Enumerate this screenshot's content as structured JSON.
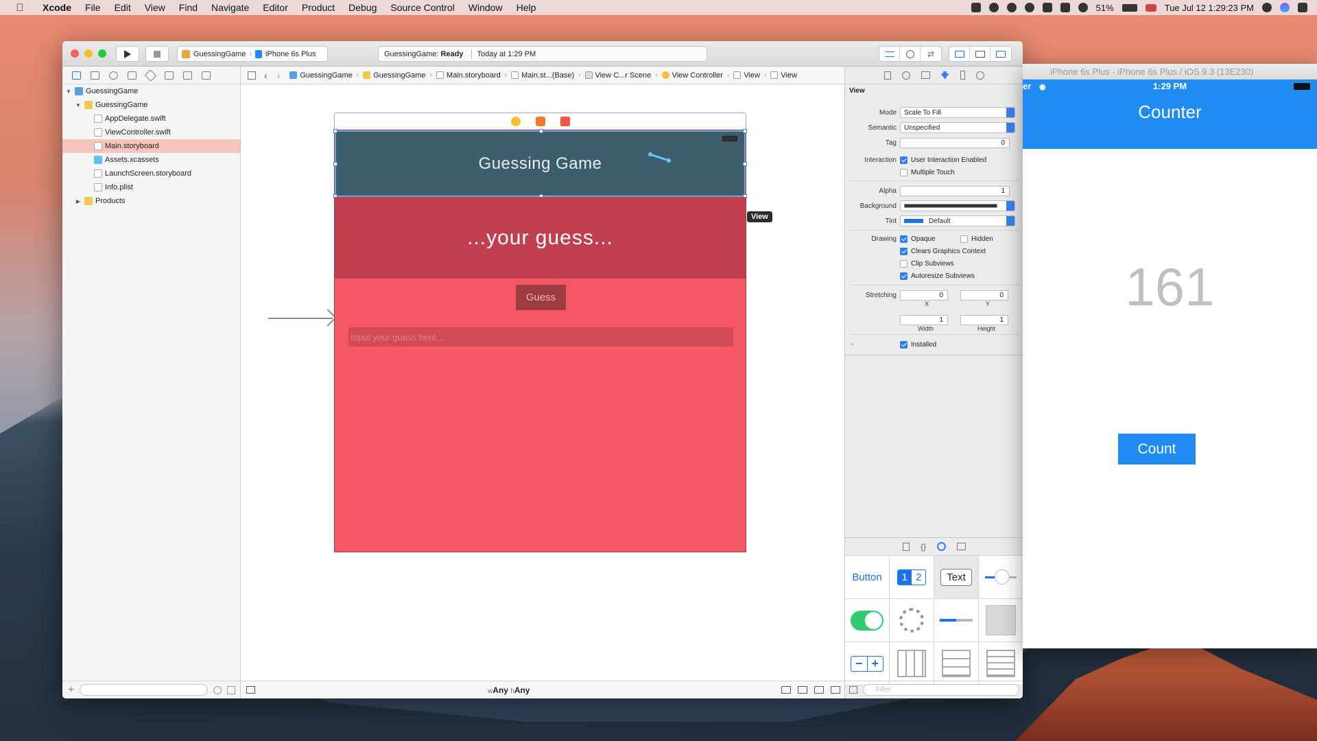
{
  "menubar": {
    "app": "Xcode",
    "items": [
      "File",
      "Edit",
      "View",
      "Find",
      "Navigate",
      "Editor",
      "Product",
      "Debug",
      "Source Control",
      "Window",
      "Help"
    ],
    "battery": "51%",
    "clock": "Tue Jul 12  1:29:23 PM"
  },
  "toolbar": {
    "scheme_project": "GuessingGame",
    "scheme_device": "iPhone 6s Plus",
    "status_project": "GuessingGame:",
    "status_state": "Ready",
    "status_time": "Today at 1:29 PM"
  },
  "navigator": {
    "items": [
      {
        "label": "GuessingGame",
        "type": "project",
        "level": 0,
        "open": true
      },
      {
        "label": "GuessingGame",
        "type": "folder",
        "level": 1,
        "open": true
      },
      {
        "label": "AppDelegate.swift",
        "type": "file",
        "level": 2
      },
      {
        "label": "ViewController.swift",
        "type": "file",
        "level": 2
      },
      {
        "label": "Main.storyboard",
        "type": "file",
        "level": 2,
        "selected": true
      },
      {
        "label": "Assets.xcassets",
        "type": "folder",
        "level": 2
      },
      {
        "label": "LaunchScreen.storyboard",
        "type": "file",
        "level": 2
      },
      {
        "label": "Info.plist",
        "type": "file",
        "level": 2
      },
      {
        "label": "Products",
        "type": "folder",
        "level": 1,
        "open": false
      }
    ]
  },
  "jumpbar": [
    "GuessingGame",
    "GuessingGame",
    "Main.storyboard",
    "Main.st...(Base)",
    "View C...r Scene",
    "View Controller",
    "View",
    "View"
  ],
  "storyboard": {
    "header_title": "Guessing Game",
    "prompt": "...your guess...",
    "guess_button": "Guess",
    "input_placeholder": "Input your guess here...",
    "selection_tag": "View",
    "size_class_w": "Any",
    "size_class_h": "Any",
    "size_prefix_w": "w",
    "size_prefix_h": "h"
  },
  "inspector": {
    "section": "View",
    "mode_label": "Mode",
    "mode": "Scale To Fill",
    "semantic_label": "Semantic",
    "semantic": "Unspecified",
    "tag_label": "Tag",
    "tag": "0",
    "interaction_label": "Interaction",
    "user_interaction": "User Interaction Enabled",
    "multiple_touch": "Multiple Touch",
    "alpha_label": "Alpha",
    "alpha": "1",
    "background_label": "Background",
    "tint_label": "Tint",
    "tint": "Default",
    "drawing_label": "Drawing",
    "opaque": "Opaque",
    "hidden": "Hidden",
    "clears": "Clears Graphics Context",
    "clip": "Clip Subviews",
    "autoresize": "Autoresize Subviews",
    "stretching_label": "Stretching",
    "stretch_x": "0",
    "stretch_y": "0",
    "stretch_w": "1",
    "stretch_h": "1",
    "x_label": "X",
    "y_label": "Y",
    "w_label": "Width",
    "h_label": "Height",
    "installed": "Installed"
  },
  "library": {
    "button": "Button",
    "seg1": "1",
    "seg2": "2",
    "text": "Text",
    "filter_placeholder": "Filter"
  },
  "simulator": {
    "title": "iPhone 6s Plus - iPhone 6s Plus / iOS 9.3 (13E230)",
    "carrier": "er",
    "time": "1:29 PM",
    "nav_title": "Counter",
    "count_value": "161",
    "count_button": "Count"
  },
  "colors": {
    "accent": "#1f8bf3",
    "header": "#3d5e6c",
    "band": "#c1404f",
    "bg_red": "#f35864"
  }
}
